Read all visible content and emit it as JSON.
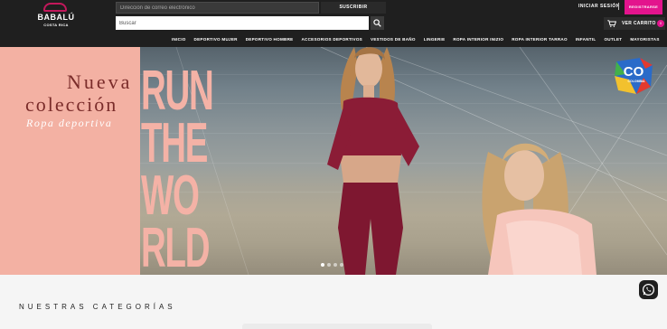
{
  "brand": {
    "name": "BABALÚ",
    "subtitle": "COSTA RICA"
  },
  "newsletter": {
    "placeholder": "Dirección de correo electrónico",
    "button": "SUSCRIBIR"
  },
  "search": {
    "placeholder": "Buscar"
  },
  "account": {
    "login": "INICIAR SESIÓN",
    "register": "REGISTRARSE"
  },
  "cart": {
    "label": "VER CARRITO",
    "count": "0"
  },
  "nav": [
    "INICIO",
    "DEPORTIVO MUJER",
    "DEPORTIVO HOMBRE",
    "ACCESORIOS DEPORTIVOS",
    "VESTIDOS DE BAÑO",
    "LINGERIE",
    "ROPA INTERIOR INIZIO",
    "ROPA INTERIOR TARRAO",
    "INFANTIL",
    "OUTLET",
    "MAYORISTAS"
  ],
  "hero": {
    "headline_1": "Nueva",
    "headline_2": "colección",
    "headline_3": "Ropa deportiva",
    "overlay_lines": [
      "RUN",
      "THE",
      "WO",
      "RLD"
    ],
    "badge_text": "CO",
    "badge_sub": "COLOMBIA",
    "slides": 4,
    "active_slide": 1
  },
  "section": {
    "title": "NUESTRAS CATEGORÍAS"
  },
  "icons": {
    "search": "search-icon",
    "cart": "cart-icon",
    "whatsapp": "whatsapp-icon"
  },
  "colors": {
    "accent": "#e3148d",
    "header": "#1f1f1f",
    "hero_pink": "#f3b1a3",
    "headline": "#7a2c2a"
  }
}
